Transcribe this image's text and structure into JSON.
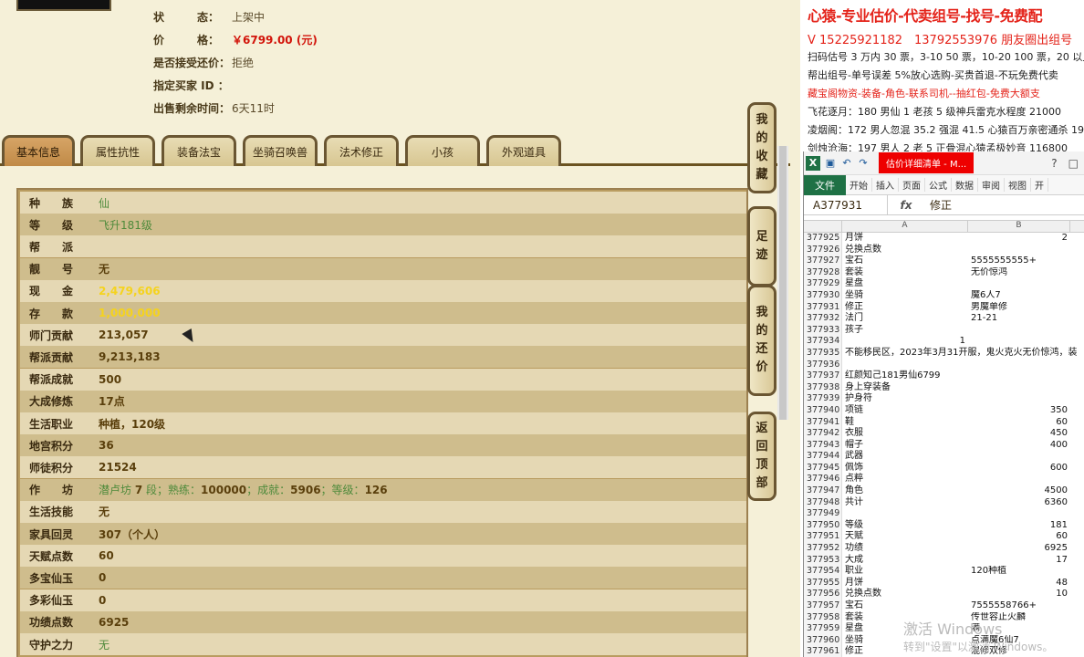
{
  "listing": [
    {
      "label": "状　　　态：",
      "value": "上架中"
    },
    {
      "label": "价　　　格：",
      "value": "￥6799.00 (元)"
    },
    {
      "label": "是否接受还价：",
      "value": "拒绝"
    },
    {
      "label": "指定买家 ID ：",
      "value": ""
    },
    {
      "label": "出售剩余时间：",
      "value": "6天11时"
    }
  ],
  "tabs": [
    "基本信息",
    "属性抗性",
    "装备法宝",
    "坐骑召唤兽",
    "法术修正",
    "小孩",
    "外观道具"
  ],
  "side_buttons": [
    {
      "chars": [
        "我",
        "的",
        "收",
        "藏"
      ]
    },
    {
      "chars": [
        "足",
        "迹"
      ]
    },
    {
      "chars": [
        "我",
        "的",
        "还",
        "价"
      ]
    },
    {
      "chars": [
        "返",
        "回",
        "顶",
        "部"
      ]
    }
  ],
  "attributes": [
    {
      "label": "种　　族",
      "value": "仙",
      "style": "green"
    },
    {
      "label": "等　　级",
      "value": "飞升181级",
      "style": "green"
    },
    {
      "label": "帮　　派",
      "value": "",
      "style": ""
    },
    {
      "label": "靓　　号",
      "value": "无",
      "style": ""
    },
    {
      "label": "现　　金",
      "value": "2,479,606",
      "style": "yellow"
    },
    {
      "label": "存　　款",
      "value": "1,000,000",
      "style": "yellow"
    },
    {
      "label": "师门贡献",
      "value": "213,057",
      "style": ""
    },
    {
      "label": "帮派贡献",
      "value": "9,213,183",
      "style": ""
    },
    {
      "label": "帮派成就",
      "value": "500",
      "style": ""
    },
    {
      "label": "大成修炼",
      "value": "17点",
      "style": ""
    },
    {
      "label": "生活职业",
      "value": "种植，120级",
      "style": ""
    },
    {
      "label": "地宫积分",
      "value": "36",
      "style": ""
    },
    {
      "label": "师徒积分",
      "value": "21524",
      "style": ""
    },
    {
      "label": "作　　坊",
      "value": "",
      "style": ""
    },
    {
      "label": "生活技能",
      "value": "无",
      "style": ""
    },
    {
      "label": "家具回灵",
      "value": "307（个人）",
      "style": ""
    },
    {
      "label": "天赋点数",
      "value": "60",
      "style": ""
    },
    {
      "label": "多宝仙玉",
      "value": "0",
      "style": ""
    },
    {
      "label": "多彩仙玉",
      "value": "0",
      "style": ""
    },
    {
      "label": "功绩点数",
      "value": "6925",
      "style": ""
    },
    {
      "label": "守护之力",
      "value": "无",
      "style": "green"
    }
  ],
  "workshop": {
    "a": "潜卢坊 ",
    "lv": "7",
    "b": " 段；熟练：",
    "exp": "100000",
    "c": "；成就：",
    "ach": "5906",
    "d": "；等级：",
    "lvl": "126"
  },
  "ads": [
    "心猿-专业估价-代卖组号-找号-免费配",
    "V 15225921182　13792553976 朋友圈出组号",
    "扫码估号 3 万内 30 票，3-10 50 票，10-20 100 票，20 以上 15",
    "帮出组号-单号误差 5%放心选购-买贵首退-不玩免费代卖",
    "藏宝阁物资-装备-角色-联系司机--抽红包-免费大额支",
    "飞花逐月：180 男仙 1 老孩 5 级神兵雷克水程度 21000",
    "凌烟阁：172 男人忽混 35.2 强混 41.5 心猿百万亲密通杀 193",
    "剑烛沧海：197 男人 2 老 5 正骨混心猿孟极妙音 116800"
  ],
  "excel": {
    "title": "估价详细清单 - M...",
    "file": "文件",
    "ribbon": [
      "开始",
      "插入",
      "页面",
      "公式",
      "数据",
      "审阅",
      "视图",
      "开"
    ],
    "namebox": "A377931",
    "fx": "fx",
    "formula": "修正",
    "col_a": "A",
    "col_b": "B",
    "rows": [
      [
        "377925",
        "月饼",
        "2"
      ],
      [
        "377926",
        "兑换点数",
        ""
      ],
      [
        "377927",
        "宝石",
        "5555555555+"
      ],
      [
        "377928",
        "套装",
        "无价惊鸿"
      ],
      [
        "377929",
        "星盘",
        ""
      ],
      [
        "377930",
        "坐骑",
        "魔6人7"
      ],
      [
        "377931",
        "修正",
        "男魔单修"
      ],
      [
        "377932",
        "法门",
        "21-21"
      ],
      [
        "377933",
        "孩子",
        ""
      ],
      [
        "377934",
        "1",
        ""
      ],
      [
        "377935",
        "不能移民区，2023年3月31开服，鬼火克火无价惊鸿，装",
        ""
      ],
      [
        "377936",
        "",
        ""
      ],
      [
        "377937",
        "红颜知己181男仙6799",
        ""
      ],
      [
        "377938",
        "身上穿装备",
        ""
      ],
      [
        "377939",
        "护身符",
        ""
      ],
      [
        "377940",
        "项链",
        "350"
      ],
      [
        "377941",
        "鞋",
        "60"
      ],
      [
        "377942",
        "衣服",
        "450"
      ],
      [
        "377943",
        "帽子",
        "400"
      ],
      [
        "377944",
        "武器",
        ""
      ],
      [
        "377945",
        "佩饰",
        "600"
      ],
      [
        "377946",
        "点粹",
        ""
      ],
      [
        "377947",
        "角色",
        "4500"
      ],
      [
        "377948",
        "共计",
        "6360"
      ],
      [
        "377949",
        "",
        ""
      ],
      [
        "377950",
        "等级",
        "181"
      ],
      [
        "377951",
        "天赋",
        "60"
      ],
      [
        "377952",
        "功绩",
        "6925"
      ],
      [
        "377953",
        "大成",
        "17"
      ],
      [
        "377954",
        "职业",
        "120种植"
      ],
      [
        "377955",
        "月饼",
        "48"
      ],
      [
        "377956",
        "兑换点数",
        "10"
      ],
      [
        "377957",
        "宝石",
        "7555558766+"
      ],
      [
        "377958",
        "套装",
        "传世容止火麟"
      ],
      [
        "377959",
        "星盘",
        "满"
      ],
      [
        "377960",
        "坐骑",
        "点满魔6仙7"
      ],
      [
        "377961",
        "修正",
        "混修双修"
      ]
    ]
  },
  "watermark": {
    "line1": "激活 Windows",
    "line2": "转到\"设置\"以激活 Windows。"
  }
}
